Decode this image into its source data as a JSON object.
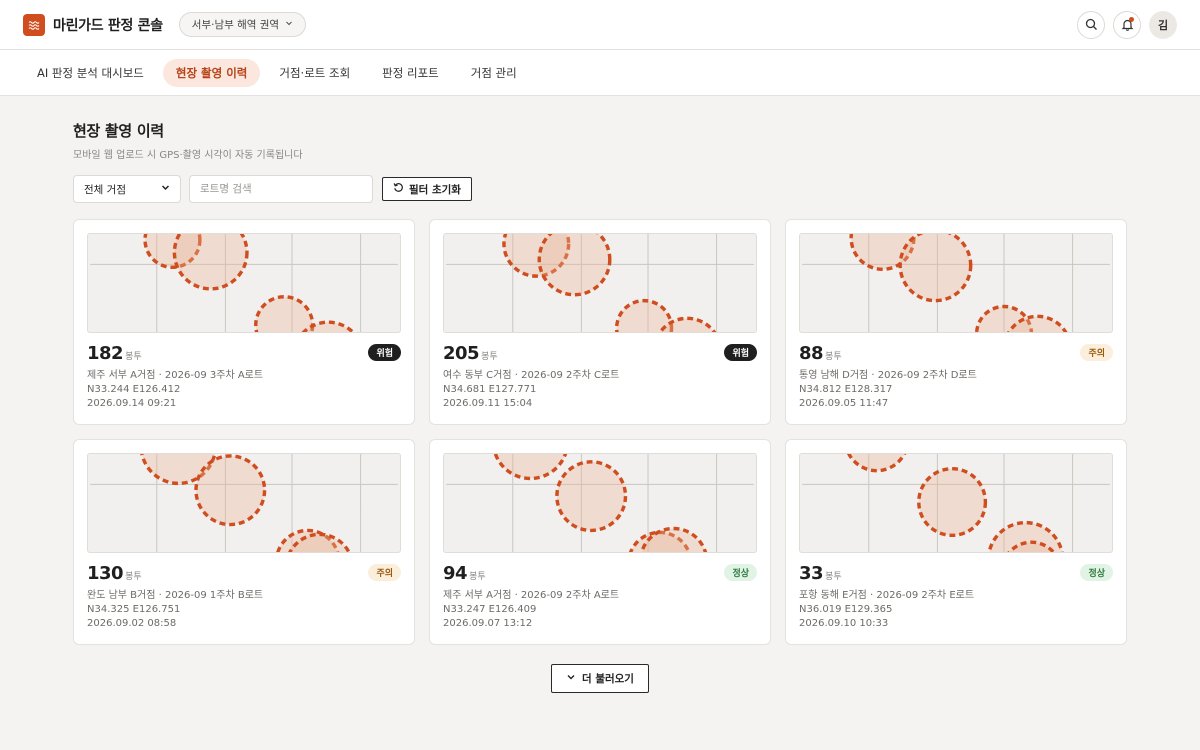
{
  "header": {
    "logo_icon": "waves-icon",
    "app_title": "마린가드 판정 콘솔",
    "region_selector": "서부·남부 해역 권역",
    "avatar_initial": "김"
  },
  "nav": {
    "tabs": [
      {
        "label": "AI 판정 분석 대시보드",
        "active": false
      },
      {
        "label": "현장 촬영 이력",
        "active": true
      },
      {
        "label": "거점·로트 조회",
        "active": false
      },
      {
        "label": "판정 리포트",
        "active": false
      },
      {
        "label": "거점 관리",
        "active": false
      }
    ]
  },
  "page": {
    "title": "현장 촬영 이력",
    "subtitle": "모바일 웹 업로드 시 GPS·촬영 시각이 자동 기록됩니다"
  },
  "filters": {
    "site_select": "전체 거점",
    "search_placeholder": "로트명 검색",
    "reset_label": "필터 초기화"
  },
  "colors": {
    "accent": "#cf4d1e",
    "danger_bg": "#1f1f1f",
    "caution_bg": "#fbefdc",
    "caution_fg": "#9a5b10",
    "normal_bg": "#e1f3e4",
    "normal_fg": "#2f7a3e"
  },
  "records": [
    {
      "count": "182",
      "unit": "봉투",
      "status": "위험",
      "status_level": "danger",
      "location": "제주 서부 A거점 · 2026-09 3주차 A로트",
      "gps": "N33.244 E126.412",
      "datetime": "2026.09.14 09:21"
    },
    {
      "count": "205",
      "unit": "봉투",
      "status": "위험",
      "status_level": "danger",
      "location": "여수 동부 C거점 · 2026-09 2주차 C로트",
      "gps": "N34.681 E127.771",
      "datetime": "2026.09.11 15:04"
    },
    {
      "count": "88",
      "unit": "봉투",
      "status": "주의",
      "status_level": "caution",
      "location": "통영 남해 D거점 · 2026-09 2주차 D로트",
      "gps": "N34.812 E128.317",
      "datetime": "2026.09.05 11:47"
    },
    {
      "count": "130",
      "unit": "봉투",
      "status": "주의",
      "status_level": "caution",
      "location": "완도 남부 B거점 · 2026-09 1주차 B로트",
      "gps": "N34.325 E126.751",
      "datetime": "2026.09.02 08:58"
    },
    {
      "count": "94",
      "unit": "봉투",
      "status": "정상",
      "status_level": "normal",
      "location": "제주 서부 A거점 · 2026-09 2주차 A로트",
      "gps": "N33.247 E126.409",
      "datetime": "2026.09.07 13:12"
    },
    {
      "count": "33",
      "unit": "봉투",
      "status": "정상",
      "status_level": "normal",
      "location": "포항 동해 E거점 · 2026-09 2주차 E로트",
      "gps": "N36.019 E129.365",
      "datetime": "2026.09.10 10:33"
    }
  ],
  "load_more_label": "더 불러오기"
}
